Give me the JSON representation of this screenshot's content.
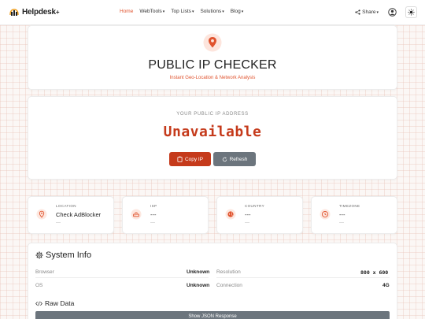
{
  "brand": {
    "name": "Helpdesk",
    "plus": "+"
  },
  "nav": {
    "links": [
      {
        "label": "Home",
        "active": true,
        "dropdown": false
      },
      {
        "label": "WebTools",
        "dropdown": true
      },
      {
        "label": "Top Lists",
        "dropdown": true
      },
      {
        "label": "Solutions",
        "dropdown": true
      },
      {
        "label": "Blog",
        "dropdown": true
      }
    ],
    "share_label": "Share",
    "caret": "▾"
  },
  "hero": {
    "title": "PUBLIC IP CHECKER",
    "subtitle": "Instant Geo-Location & Network Analysis"
  },
  "ip": {
    "label": "YOUR PUBLIC IP ADDRESS",
    "value": "Unavailable",
    "copy_label": "Copy IP",
    "refresh_label": "Refresh"
  },
  "info_cards": [
    {
      "label": "LOCATION",
      "value": "Check AdBlocker",
      "sub": "---",
      "icon": "map-pin-icon"
    },
    {
      "label": "ISP",
      "value": "---",
      "sub": "---",
      "icon": "router-icon"
    },
    {
      "label": "COUNTRY",
      "value": "---",
      "sub": "---",
      "icon": "globe-icon"
    },
    {
      "label": "TIMEZONE",
      "value": "---",
      "sub": "---",
      "icon": "clock-icon"
    }
  ],
  "system": {
    "title": "System Info",
    "rows": [
      {
        "label": "Browser",
        "value": "Unknown"
      },
      {
        "label": "Resolution",
        "value": "800 x 600"
      },
      {
        "label": "OS",
        "value": "Unknown"
      },
      {
        "label": "Connection",
        "value": "4G"
      }
    ]
  },
  "raw": {
    "title": "Raw Data",
    "button_label": "Show JSON Response"
  },
  "colors": {
    "accent": "#e0532e",
    "accent_dark": "#c53a1b",
    "secondary": "#6c757d"
  }
}
